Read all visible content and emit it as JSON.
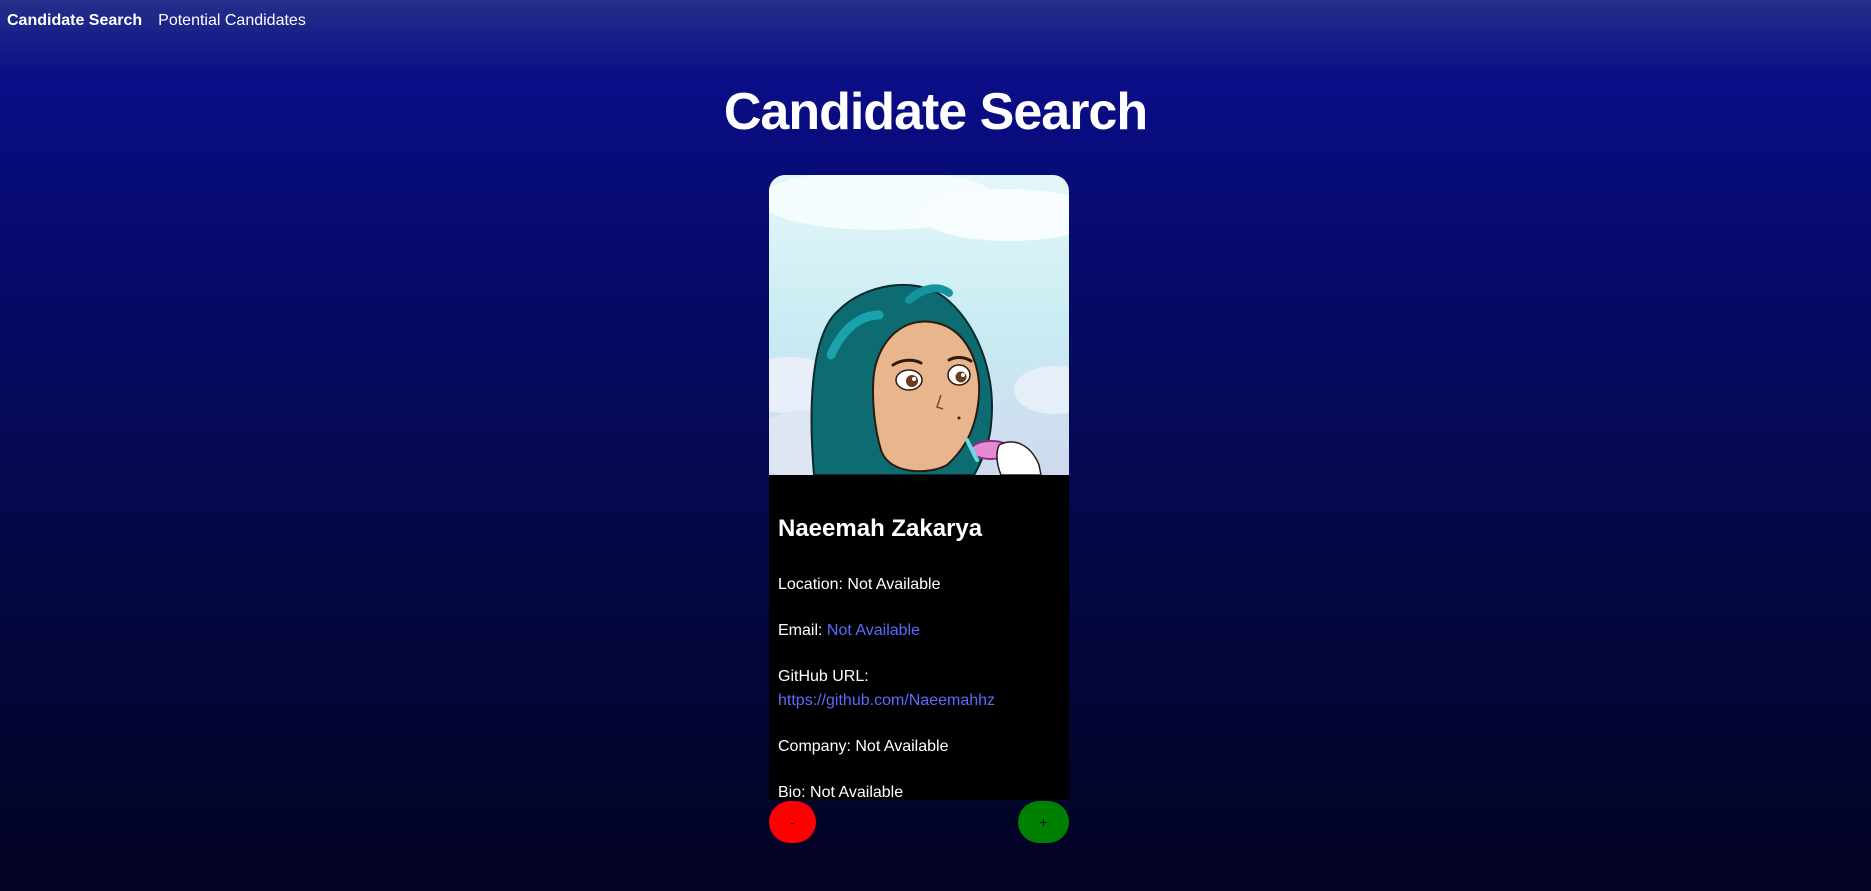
{
  "nav": {
    "items": [
      {
        "label": "Candidate Search"
      },
      {
        "label": "Potential Candidates"
      }
    ]
  },
  "page": {
    "title": "Candidate Search"
  },
  "candidate": {
    "name": "Naeemah Zakarya",
    "location_label": "Location:",
    "location_value": "Not Available",
    "email_label": "Email:",
    "email_value": "Not Available",
    "github_label": "GitHub URL:",
    "github_value": "https://github.com/Naeemahhz",
    "company_label": "Company:",
    "company_value": "Not Available",
    "bio_label": "Bio:",
    "bio_value": "Not Available"
  },
  "actions": {
    "reject_label": "-",
    "accept_label": "+"
  },
  "colors": {
    "link": "#5b6bff",
    "reject": "#ff0000",
    "accept": "#008000"
  }
}
